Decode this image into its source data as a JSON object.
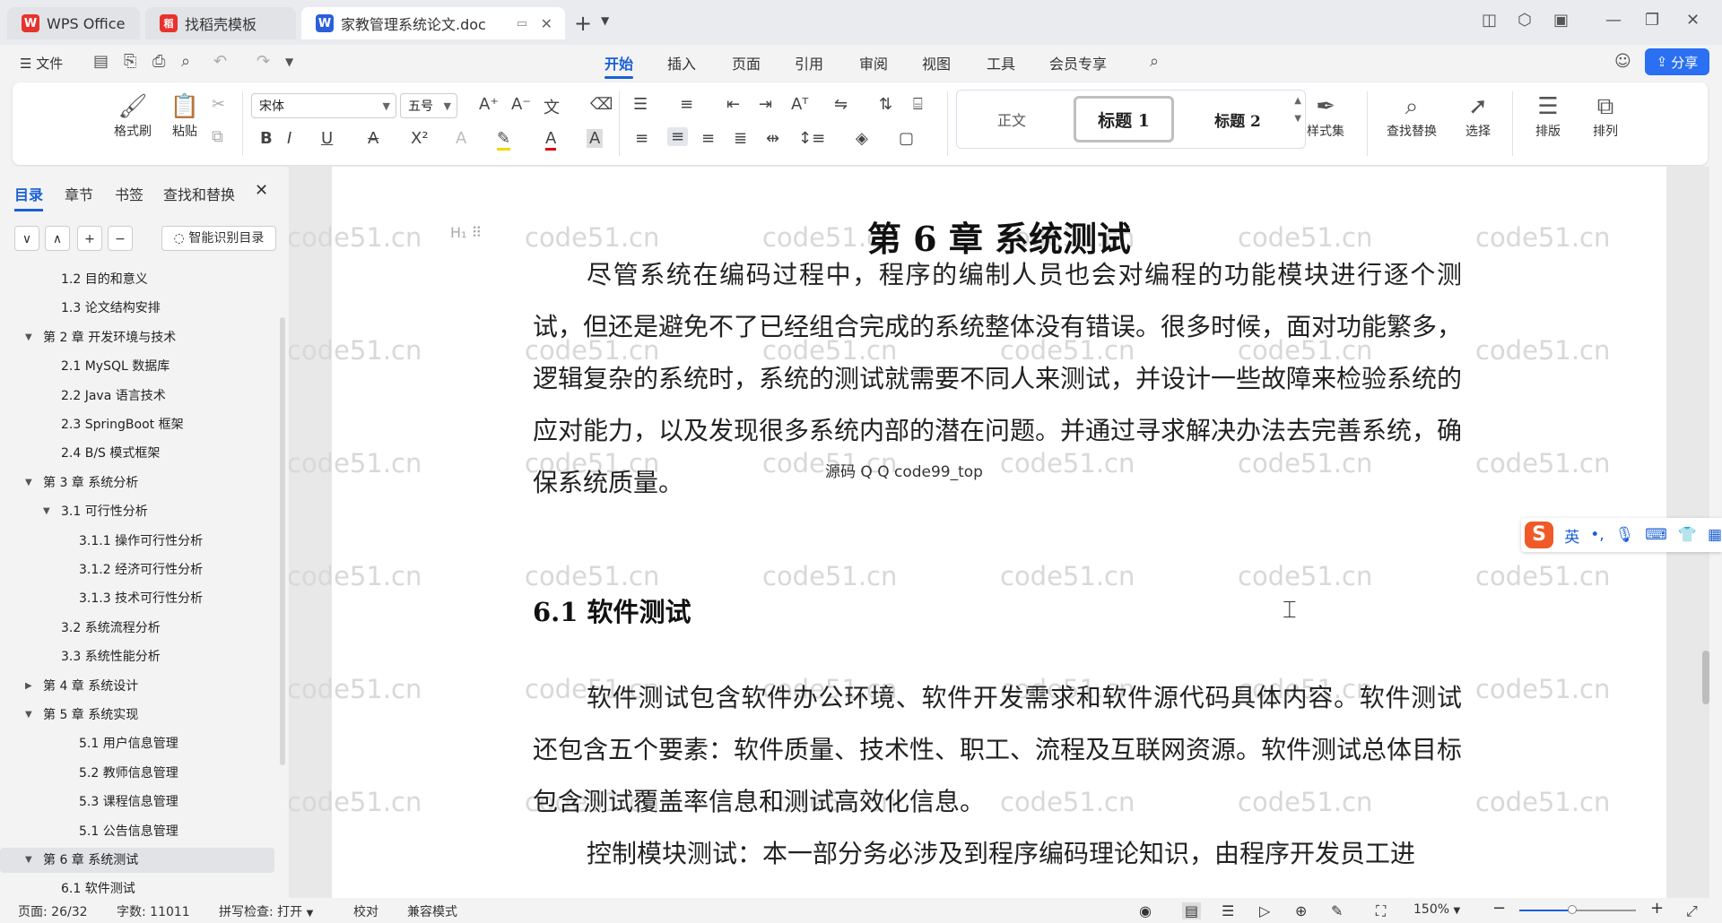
{
  "tabs": [
    {
      "logo": "W",
      "label": "WPS Office",
      "color": "#e8322d"
    },
    {
      "logo": "稻",
      "label": "找稻壳模板",
      "color": "#e8322d"
    },
    {
      "logo": "W",
      "label": "家教管理系统论文.doc",
      "color": "#2b5fd9"
    }
  ],
  "menu": {
    "file": "☰ 文件",
    "tabs": [
      "开始",
      "插入",
      "页面",
      "引用",
      "审阅",
      "视图",
      "工具",
      "会员专享"
    ],
    "share": "分享"
  },
  "ribbon": {
    "format_painter": "格式刷",
    "paste": "粘贴",
    "font_name": "宋体",
    "font_size": "五号",
    "styles": {
      "normal": "正文",
      "h1": "标题 1",
      "h2": "标题 2"
    },
    "style_set": "样式集",
    "find_replace": "查找替换",
    "select": "选择",
    "layout": "排版",
    "arrange": "排列"
  },
  "nav": {
    "tabs": [
      "目录",
      "章节",
      "书签",
      "查找和替换"
    ],
    "smart_toc": "智能识别目录",
    "toc": [
      {
        "label": "1.2 目的和意义",
        "level": 2
      },
      {
        "label": "1.3 论文结构安排",
        "level": 2
      },
      {
        "label": "第 2 章  开发环境与技术",
        "level": 1,
        "expanded": true
      },
      {
        "label": "2.1 MySQL 数据库",
        "level": 2
      },
      {
        "label": "2.2 Java 语言技术",
        "level": 2
      },
      {
        "label": "2.3 SpringBoot 框架",
        "level": 2
      },
      {
        "label": "2.4 B/S 模式框架",
        "level": 2
      },
      {
        "label": "第 3 章  系统分析",
        "level": 1,
        "expanded": true
      },
      {
        "label": "3.1 可行性分析",
        "level": 2,
        "expanded": true
      },
      {
        "label": "3.1.1 操作可行性分析",
        "level": 3
      },
      {
        "label": "3.1.2 经济可行性分析",
        "level": 3
      },
      {
        "label": "3.1.3 技术可行性分析",
        "level": 3
      },
      {
        "label": "3.2 系统流程分析",
        "level": 2
      },
      {
        "label": "3.3 系统性能分析",
        "level": 2
      },
      {
        "label": "第 4 章  系统设计",
        "level": 1,
        "expanded": false
      },
      {
        "label": "第 5 章  系统实现",
        "level": 1,
        "expanded": true
      },
      {
        "label": "5.1 用户信息管理",
        "level": 3
      },
      {
        "label": "5.2  教师信息管理",
        "level": 3
      },
      {
        "label": "5.3 课程信息管理",
        "level": 3
      },
      {
        "label": "5.1 公告信息管理",
        "level": 3
      },
      {
        "label": "第 6 章  系统测试",
        "level": 1,
        "expanded": true,
        "selected": true
      },
      {
        "label": "6.1 软件测试",
        "level": 2
      }
    ]
  },
  "document": {
    "chapter_title": "第 6 章  系统测试",
    "heading_marker": "H₁",
    "para1": "尽管系统在编码过程中，程序的编制人员也会对编程的功能模块进行逐个测试，但还是避免不了已经组合完成的系统整体没有错误。很多时候，面对功能繁多，逻辑复杂的系统时，系统的测试就需要不同人来测试，并设计一些故障来检验系统的应对能力，以及发现很多系统内部的潜在问题。并通过寻求解决办法去完善系统，确保系统质量。",
    "section_title": "6.1 软件测试",
    "para2": "软件测试包含软件办公环境、软件开发需求和软件源代码具体内容。软件测试还包含五个要素：软件质量、技术性、职工、流程及互联网资源。软件测试总体目标包含测试覆盖率信息和测试高效化信息。",
    "para3": "控制模块测试：本一部分务必涉及到程序编码理论知识，由程序开发员工进",
    "overlay": "源码 Q Q code99_top",
    "watermark": "code51.cn"
  },
  "ime": {
    "mode": "英",
    "punct": "•,"
  },
  "status": {
    "page": "页面: 26/32",
    "words": "字数: 11011",
    "spell": "拼写检查: 打开",
    "proof": "校对",
    "compat": "兼容模式",
    "zoom": "150%",
    "zoom_fraction": 0.45
  }
}
